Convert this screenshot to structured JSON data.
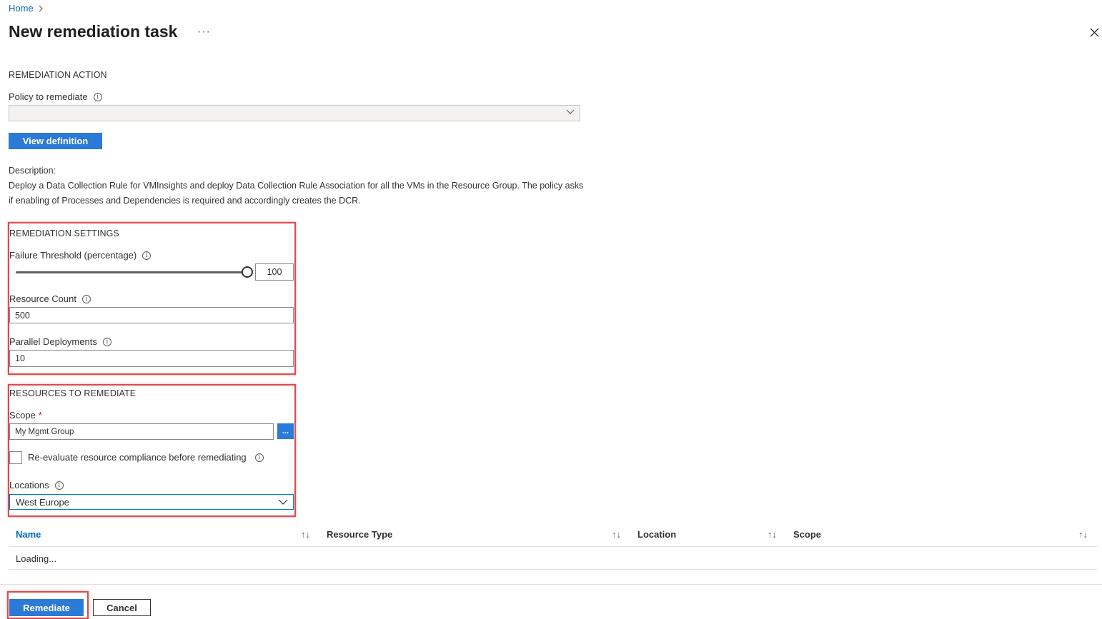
{
  "breadcrumb": {
    "home": "Home",
    "sep": ">"
  },
  "header": {
    "title": "New remediation task",
    "more": "···"
  },
  "remediation_action": {
    "heading": "REMEDIATION ACTION",
    "policy_label": "Policy to remediate",
    "policy_value": "",
    "view_definition": "View definition",
    "description_label": "Description:",
    "description_text": "Deploy a Data Collection Rule for VMInsights and deploy Data Collection Rule Association for all the VMs in the Resource Group. The policy asks if enabling of Processes and Dependencies is required and accordingly creates the DCR."
  },
  "remediation_settings": {
    "heading": "REMEDIATION SETTINGS",
    "failure_threshold_label": "Failure Threshold (percentage)",
    "failure_threshold_value": "100",
    "failure_threshold_fraction": 1.0,
    "resource_count_label": "Resource Count",
    "resource_count_value": "500",
    "parallel_deployments_label": "Parallel Deployments",
    "parallel_deployments_value": "10"
  },
  "resources": {
    "heading": "RESOURCES TO REMEDIATE",
    "scope_label": "Scope",
    "scope_required": "*",
    "scope_value": "My Mgmt Group",
    "browse_label": "...",
    "reevaluate_label": "Re-evaluate resource compliance before remediating",
    "reevaluate_checked": false,
    "locations_label": "Locations",
    "locations_value": "West Europe"
  },
  "table": {
    "columns": [
      "Name",
      "Resource Type",
      "Location",
      "Scope"
    ],
    "sort_glyph": "↑↓",
    "loading": "Loading..."
  },
  "footer": {
    "remediate": "Remediate",
    "cancel": "Cancel"
  },
  "colors": {
    "accent": "#2b7ad8",
    "highlight": "#e04a4a",
    "link": "#0067b8"
  },
  "icons": {
    "info": "info-icon",
    "close": "close-icon",
    "chevron": "chevron-down-icon",
    "sort": "sort-icon"
  }
}
